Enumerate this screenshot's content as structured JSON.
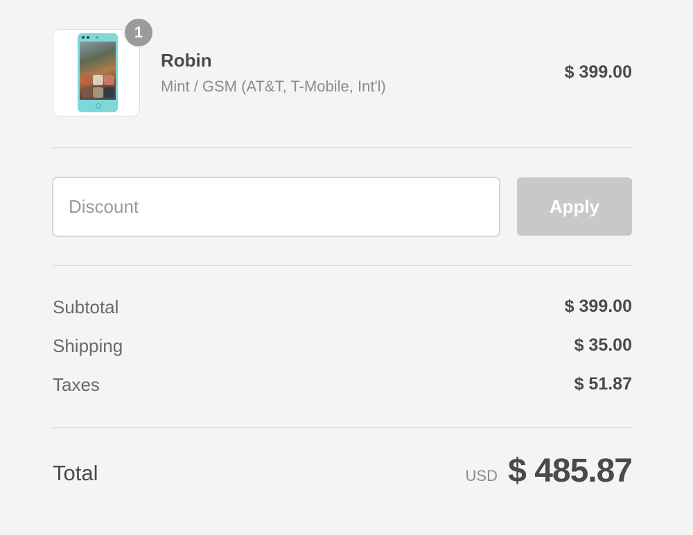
{
  "cart": {
    "item": {
      "quantity": "1",
      "name": "Robin",
      "variant": "Mint / GSM (AT&T, T-Mobile, Int'l)",
      "price": "$ 399.00",
      "image_icon": "phone-product-image"
    }
  },
  "discount": {
    "placeholder": "Discount",
    "value": "",
    "apply_label": "Apply"
  },
  "costs": {
    "subtotal": {
      "label": "Subtotal",
      "value": "$ 399.00"
    },
    "shipping": {
      "label": "Shipping",
      "value": "$ 35.00"
    },
    "taxes": {
      "label": "Taxes",
      "value": "$ 51.87"
    }
  },
  "total": {
    "label": "Total",
    "currency": "USD",
    "amount": "$ 485.87"
  },
  "colors": {
    "background": "#f4f4f4",
    "badge": "#9b9b9b",
    "apply_button": "#c8c8c8",
    "text": "#4a4a4a",
    "muted_text": "#8c8c8c"
  }
}
